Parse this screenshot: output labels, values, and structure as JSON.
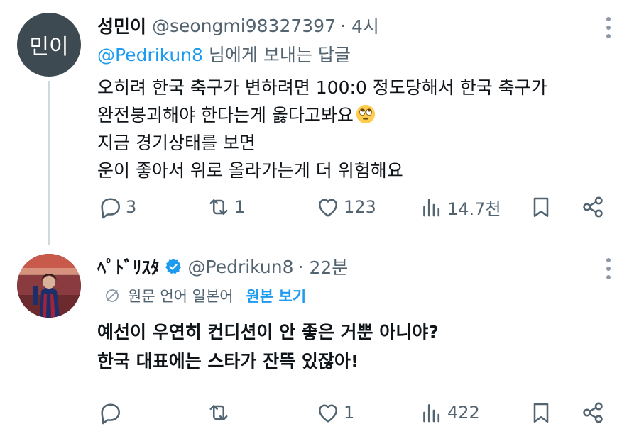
{
  "tweet1": {
    "avatar_text": "민이",
    "name": "성민이",
    "handle": "@seongmi98327397",
    "separator": "·",
    "time": "4시",
    "reply_to_mention": "@Pedrikun8",
    "reply_to_suffix": "님에게 보내는 답글",
    "lines": [
      "오히려 한국 축구가 변하려면 100:0 정도당해서 한국 축구가",
      "완전붕괴해야 한다는게 옳다고봐요",
      "지금 경기상태를 보면",
      "운이 좋아서 위로 올라가는게 더 위험해요"
    ],
    "emoji": "face-with-rolling-eyes-icon",
    "replies": "3",
    "reposts": "1",
    "likes": "123",
    "views": "14.7천"
  },
  "tweet2": {
    "name": "ﾍﾟﾄﾞﾘｽﾀ",
    "handle": "@Pedrikun8",
    "separator": "·",
    "time": "22분",
    "translate_label": "원문 언어 일본어",
    "translate_link": "원본 보기",
    "lines": [
      "예선이 우연히 컨디션이 안 좋은 거뿐 아니야?",
      "한국 대표에는 스타가 잔뜩 있잖아!"
    ],
    "replies": "",
    "reposts": "",
    "likes": "1",
    "views": "422"
  },
  "colors": {
    "text": "#0f1419",
    "secondary": "#536471",
    "link": "#1d9bf0",
    "thread_line": "#cfd9de",
    "avatar_bg": "#3d4a52"
  }
}
